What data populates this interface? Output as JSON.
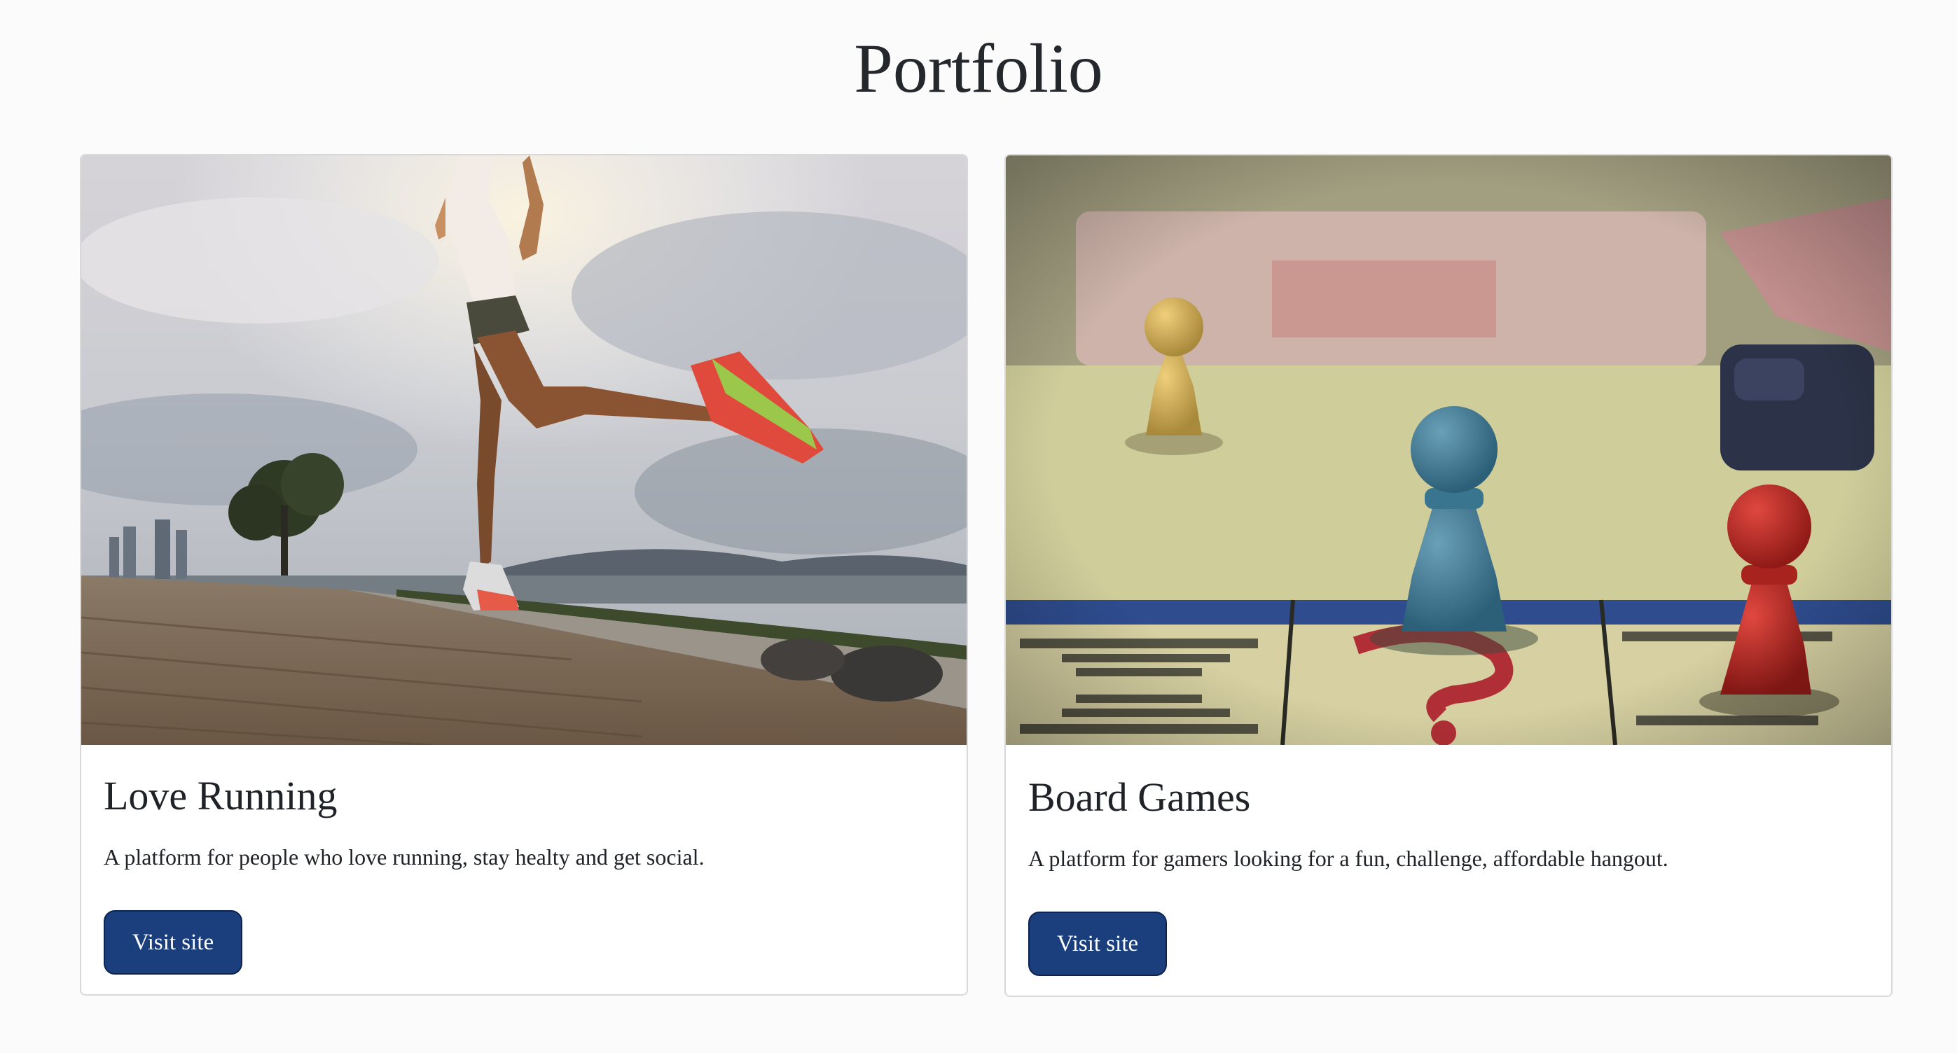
{
  "page": {
    "title": "Portfolio"
  },
  "projects": [
    {
      "title": "Love Running",
      "description": "A platform for people who love running, stay healty and get social.",
      "button_label": "Visit site",
      "image": "runner-photo"
    },
    {
      "title": "Board Games",
      "description": "A platform for gamers looking for a fun, challenge, affordable hangout.",
      "button_label": "Visit site",
      "image": "board-game-pawns-photo"
    }
  ],
  "colors": {
    "background": "#fbfbfb",
    "card": "#ffffff",
    "button": "#1b3e7d",
    "button_text": "#ffffff",
    "text": "#212529"
  }
}
